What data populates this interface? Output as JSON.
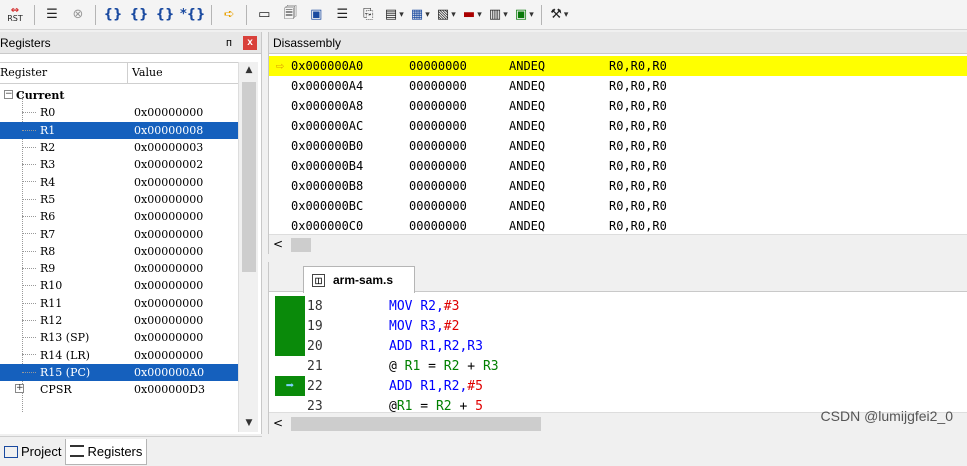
{
  "toolbar": {
    "rst_label": "RST",
    "icons": [
      "reset-icon",
      "step-into-icon",
      "stop-icon",
      "step-icon",
      "step-over-icon",
      "step-out-icon",
      "run-to-cursor-icon",
      "show-next-statement-icon",
      "command-window-icon",
      "disassembly-window-icon",
      "symbols-window-icon",
      "registers-window-icon",
      "call-stack-icon",
      "watch-window-icon",
      "memory-window-icon",
      "serial-window-icon",
      "analysis-window-icon",
      "trace-window-icon",
      "system-viewer-icon",
      "toolbox-icon"
    ]
  },
  "registers_panel": {
    "title": "Registers",
    "pin_symbol": "ᴨ",
    "close_symbol": "x",
    "columns": {
      "name": "Register",
      "value": "Value"
    },
    "group": "Current",
    "rows": [
      {
        "name": "R0",
        "value": "0x00000000"
      },
      {
        "name": "R1",
        "value": "0x00000008"
      },
      {
        "name": "R2",
        "value": "0x00000003"
      },
      {
        "name": "R3",
        "value": "0x00000002"
      },
      {
        "name": "R4",
        "value": "0x00000000"
      },
      {
        "name": "R5",
        "value": "0x00000000"
      },
      {
        "name": "R6",
        "value": "0x00000000"
      },
      {
        "name": "R7",
        "value": "0x00000000"
      },
      {
        "name": "R8",
        "value": "0x00000000"
      },
      {
        "name": "R9",
        "value": "0x00000000"
      },
      {
        "name": "R10",
        "value": "0x00000000"
      },
      {
        "name": "R11",
        "value": "0x00000000"
      },
      {
        "name": "R12",
        "value": "0x00000000"
      },
      {
        "name": "R13 (SP)",
        "value": "0x00000000"
      },
      {
        "name": "R14 (LR)",
        "value": "0x00000000"
      },
      {
        "name": "R15 (PC)",
        "value": "0x000000A0"
      },
      {
        "name": "CPSR",
        "value": "0x000000D3"
      }
    ],
    "selected_rows": [
      "R1",
      "R15 (PC)"
    ],
    "tabs": [
      {
        "label": "Project",
        "active": false
      },
      {
        "label": "Registers",
        "active": true
      }
    ]
  },
  "disassembly": {
    "title": "Disassembly",
    "rows": [
      {
        "addr": "0x000000A0",
        "code": "00000000",
        "mnem": "ANDEQ",
        "ops": "R0,R0,R0",
        "current": true
      },
      {
        "addr": "0x000000A4",
        "code": "00000000",
        "mnem": "ANDEQ",
        "ops": "R0,R0,R0"
      },
      {
        "addr": "0x000000A8",
        "code": "00000000",
        "mnem": "ANDEQ",
        "ops": "R0,R0,R0"
      },
      {
        "addr": "0x000000AC",
        "code": "00000000",
        "mnem": "ANDEQ",
        "ops": "R0,R0,R0"
      },
      {
        "addr": "0x000000B0",
        "code": "00000000",
        "mnem": "ANDEQ",
        "ops": "R0,R0,R0"
      },
      {
        "addr": "0x000000B4",
        "code": "00000000",
        "mnem": "ANDEQ",
        "ops": "R0,R0,R0"
      },
      {
        "addr": "0x000000B8",
        "code": "00000000",
        "mnem": "ANDEQ",
        "ops": "R0,R0,R0"
      },
      {
        "addr": "0x000000BC",
        "code": "00000000",
        "mnem": "ANDEQ",
        "ops": "R0,R0,R0"
      },
      {
        "addr": "0x000000C0",
        "code": "00000000",
        "mnem": "ANDEQ",
        "ops": "R0,R0,R0"
      }
    ]
  },
  "editor": {
    "tab_label": "arm-sam.s",
    "lines": [
      {
        "ln": "18",
        "code": "MOV R2,#3",
        "marker": "green"
      },
      {
        "ln": "19",
        "code": "MOV R3,#2",
        "marker": "green"
      },
      {
        "ln": "20",
        "code": "ADD R1,R2,R3",
        "marker": "green"
      },
      {
        "ln": "21",
        "code": "@ R1 = R2 + R3",
        "marker": "none"
      },
      {
        "ln": "22",
        "code": "ADD R1,R2,#5",
        "marker": "pc"
      },
      {
        "ln": "23",
        "code": "@R1 = R2 + 5",
        "marker": "none"
      }
    ]
  },
  "watermark": "CSDN @lumijgfei2_0",
  "colors": {
    "selection": "#1560bd",
    "current_line": "#ffff00",
    "executed_marker": "#0a8a0a",
    "keyword": "#0000ff",
    "number": "#e00000"
  }
}
